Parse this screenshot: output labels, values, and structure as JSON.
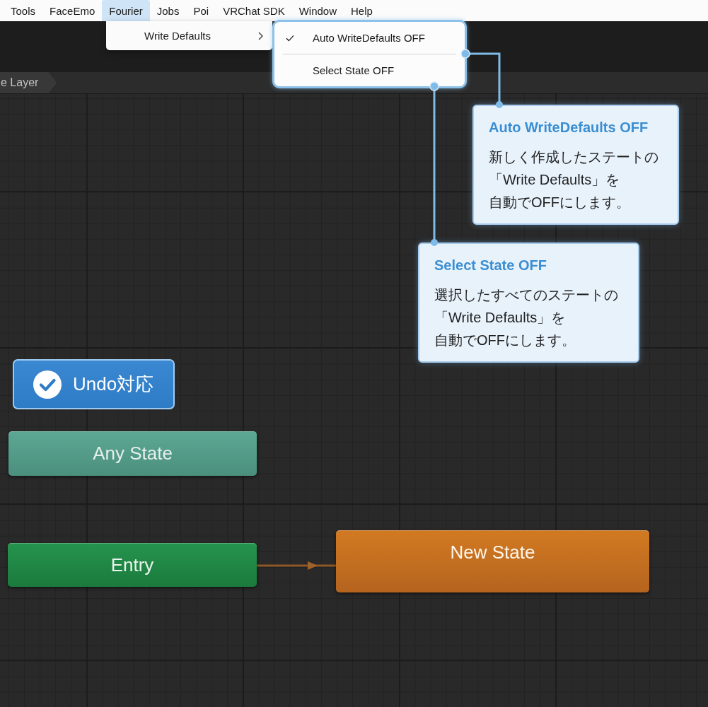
{
  "menu_bar": {
    "items": [
      {
        "label": "Tools",
        "selected": false
      },
      {
        "label": "FaceEmo",
        "selected": false
      },
      {
        "label": "Fourier",
        "selected": true
      },
      {
        "label": "Jobs",
        "selected": false
      },
      {
        "label": "Poi",
        "selected": false
      },
      {
        "label": "VRChat SDK",
        "selected": false
      },
      {
        "label": "Window",
        "selected": false
      },
      {
        "label": "Help",
        "selected": false
      }
    ]
  },
  "dropdown": {
    "items": [
      {
        "label": "Write Defaults"
      }
    ]
  },
  "submenu": {
    "items": [
      {
        "label": "Auto WriteDefaults OFF",
        "checked": true
      },
      {
        "label": "Select State OFF",
        "checked": false
      }
    ]
  },
  "breadcrumb": {
    "items": [
      {
        "label": "e Layer"
      }
    ]
  },
  "callouts": [
    {
      "title": "Auto WriteDefaults OFF",
      "text": "新しく作成したステートの「Write Defaults」を自動でOFFにします。"
    },
    {
      "title": "Select State OFF",
      "text": "選択したすべてのステートの「Write Defaults」を自動でOFFにします。"
    }
  ],
  "badge": {
    "label": "Undo対応"
  },
  "graph": {
    "nodes": [
      {
        "label": "Any State",
        "kind": "any_state"
      },
      {
        "label": "Entry",
        "kind": "entry"
      },
      {
        "label": "New State",
        "kind": "default_state"
      }
    ]
  }
}
